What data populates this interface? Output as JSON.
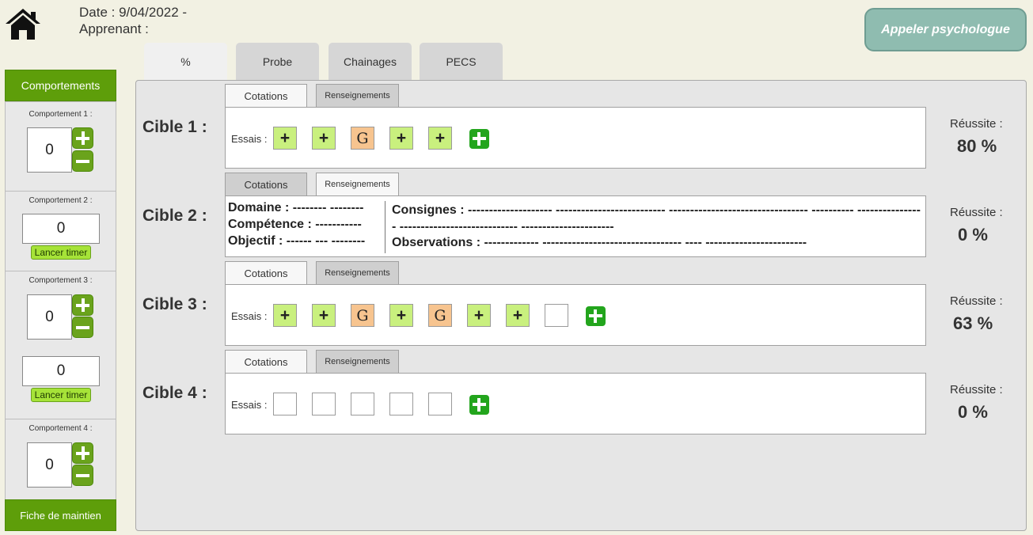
{
  "header": {
    "date_line": "Date : 9/04/2022 -",
    "apprenant_line": "Apprenant :",
    "call_button": "Appeler psychologue"
  },
  "tabs": [
    {
      "label": "%",
      "active": true
    },
    {
      "label": "Probe",
      "active": false
    },
    {
      "label": "Chainages",
      "active": false
    },
    {
      "label": "PECS",
      "active": false
    }
  ],
  "sidebar": {
    "title": "Comportements",
    "behaviors": [
      {
        "label": "Comportement 1 :",
        "count": "0"
      },
      {
        "label": "Comportement 2 :",
        "timer": "0",
        "timer_button": "Lancer timer"
      },
      {
        "label": "Comportement 3 :",
        "count": "0",
        "timer": "0",
        "timer_button": "Lancer timer"
      },
      {
        "label": "Comportement 4 :",
        "count": "0"
      }
    ],
    "footer_button": "Fiche de maintien"
  },
  "main": {
    "cotations_label": "Cotations",
    "renseignements_label": "Renseignements",
    "essais_label": "Essais :",
    "reussite_label": "Réussite :",
    "cibles": [
      {
        "label": "Cible 1 :",
        "view": "cotations",
        "trials": [
          "+",
          "+",
          "G",
          "+",
          "+"
        ],
        "reussite": "80 %"
      },
      {
        "label": "Cible 2 :",
        "view": "renseignements",
        "reussite": "0 %",
        "info": {
          "domaine": "Domaine : -------- --------",
          "competence": "Compétence : -----------",
          "objectif": "Objectif : ------ --- --------",
          "consignes": "Consignes : -------------------- -------------------------- --------------------------------- ---------- ---------------- ---------------------------- ----------------------",
          "observations": "Observations : ------------- --------------------------------- ---- ------------------------"
        }
      },
      {
        "label": "Cible 3 :",
        "view": "cotations",
        "trials": [
          "+",
          "+",
          "G",
          "+",
          "G",
          "+",
          "+",
          ""
        ],
        "reussite": "63 %"
      },
      {
        "label": "Cible 4 :",
        "view": "cotations",
        "trials": [
          "",
          "",
          "",
          "",
          ""
        ],
        "reussite": "0 %"
      }
    ]
  },
  "colors": {
    "accent_green": "#5e9e0a",
    "plus_cell": "#c9f07e",
    "g_cell": "#f7c48f",
    "call_button_bg": "#8fbcb0"
  },
  "icons": [
    "home-icon",
    "plus-icon",
    "minus-icon",
    "add-icon"
  ]
}
